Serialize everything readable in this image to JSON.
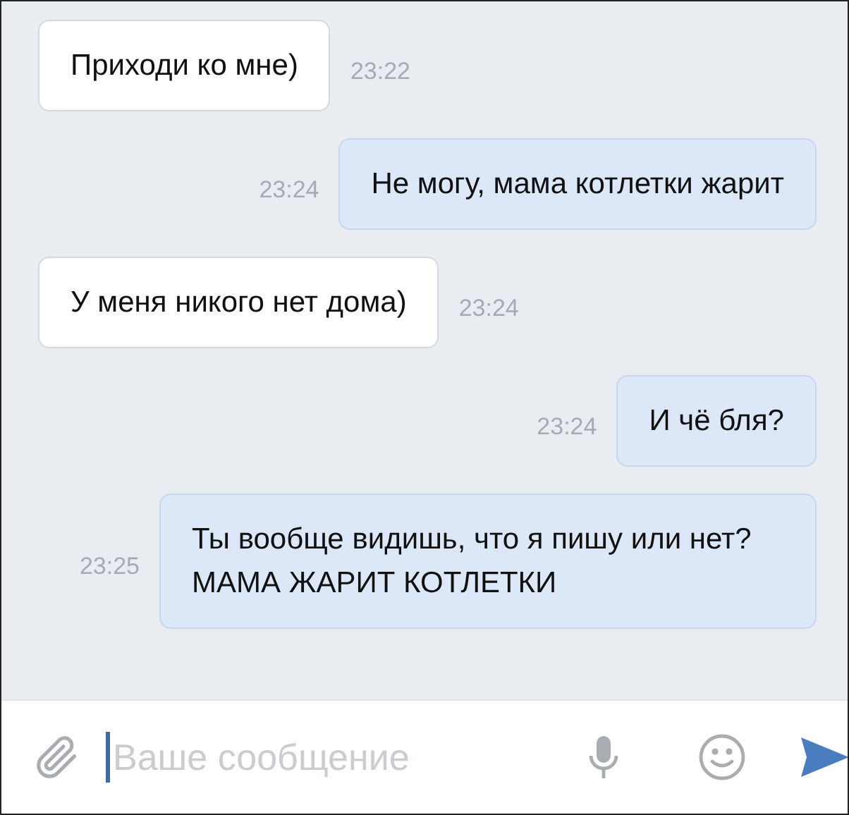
{
  "messages": [
    {
      "kind": "incoming",
      "text": "Приходи ко мне)",
      "time": "23:22"
    },
    {
      "kind": "outgoing",
      "text": "Не могу, мама котлетки жарит",
      "time": "23:24"
    },
    {
      "kind": "incoming",
      "text": "У меня никого нет дома)",
      "time": "23:24"
    },
    {
      "kind": "outgoing",
      "text": "И чё бля?",
      "time": "23:24"
    },
    {
      "kind": "outgoing",
      "text": "Ты вообще видишь, что я пишу или нет? МАМА ЖАРИТ КОТЛЕТКИ",
      "time": "23:25"
    }
  ],
  "composer": {
    "placeholder": "Ваше сообщение"
  }
}
